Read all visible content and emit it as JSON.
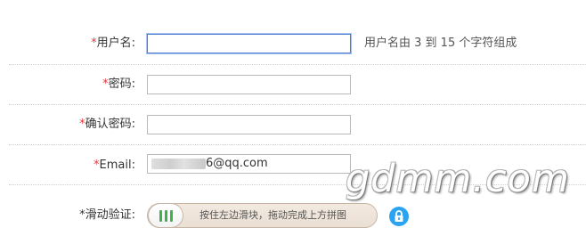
{
  "form": {
    "username": {
      "required_mark": "*",
      "label": "用户名:",
      "value": "",
      "hint": "用户名由 3 到 15 个字符组成"
    },
    "password": {
      "required_mark": "*",
      "label": "密码:",
      "value": ""
    },
    "confirm_password": {
      "required_mark": "*",
      "label": "确认密码:",
      "value": ""
    },
    "email": {
      "required_mark": "*",
      "label": "Email:",
      "visible_value": "6@qq.com"
    },
    "captcha": {
      "label": "*滑动验证:",
      "instruction": "按住左边滑块，拖动完成上方拼图",
      "handle_icon": "grip-lines-icon",
      "lock_icon": "lock-icon"
    }
  },
  "watermark": {
    "text": "gdmm.com"
  },
  "colors": {
    "required": "#e4393c",
    "focus_border": "#4c7ccf",
    "grip": "#3fb24a",
    "lock_bg": "#2aa3f0",
    "slider_bg": "#eadfd3"
  }
}
